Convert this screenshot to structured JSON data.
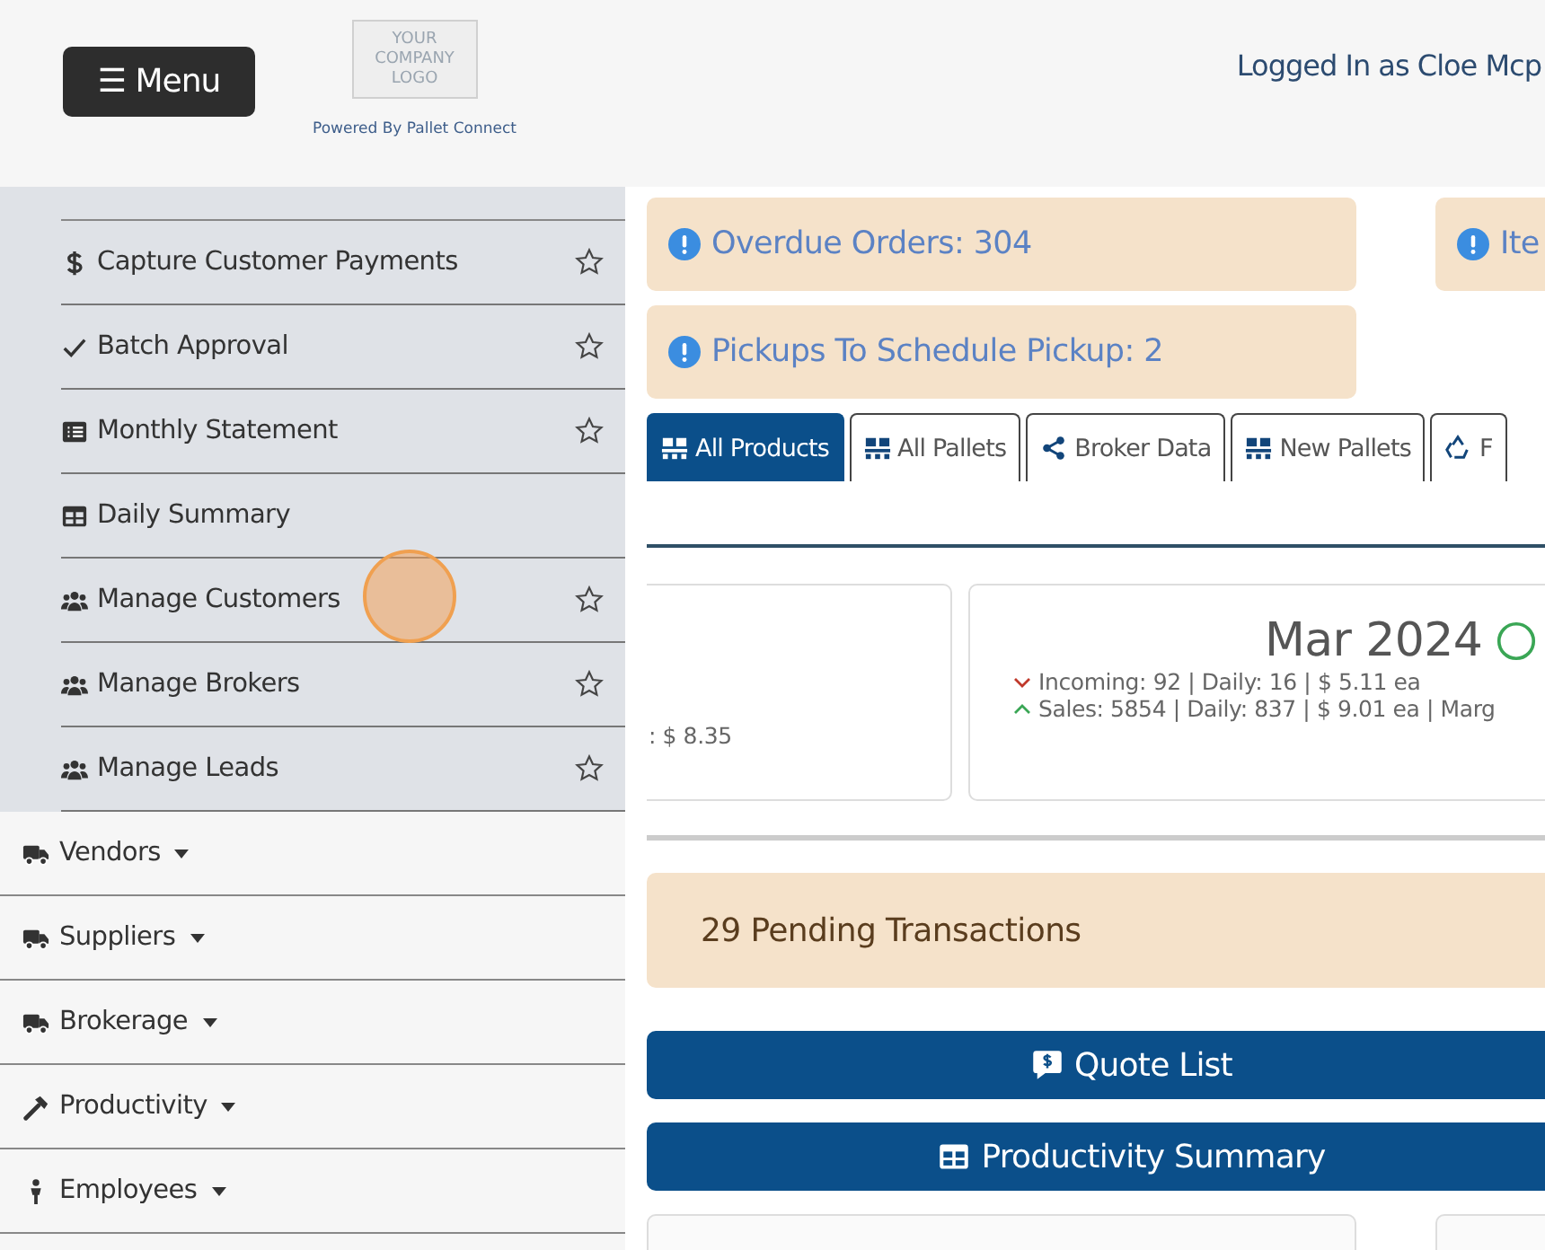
{
  "header": {
    "menu_button": "☰ Menu",
    "logo_lines": [
      "YOUR",
      "COMPANY",
      "LOGO"
    ],
    "powered_by": "Powered By Pallet Connect",
    "user": "Logged In as Cloe Mcp"
  },
  "sidebar": {
    "submenu": [
      {
        "kind": "dollar",
        "label": "Capture Customer Payments",
        "star": true
      },
      {
        "kind": "check",
        "label": "Batch Approval",
        "star": true
      },
      {
        "kind": "list",
        "label": "Monthly Statement",
        "star": true
      },
      {
        "kind": "table",
        "label": "Daily Summary",
        "star": false
      },
      {
        "kind": "users",
        "label": "Manage Customers",
        "star": true
      },
      {
        "kind": "users",
        "label": "Manage Brokers",
        "star": true
      },
      {
        "kind": "users",
        "label": "Manage Leads",
        "star": true
      }
    ],
    "menus": [
      {
        "kind": "truck",
        "label": "Vendors"
      },
      {
        "kind": "truck",
        "label": "Suppliers"
      },
      {
        "kind": "truck",
        "label": "Brokerage"
      },
      {
        "kind": "hammer",
        "label": "Productivity"
      },
      {
        "kind": "person",
        "label": "Employees"
      }
    ]
  },
  "alerts": [
    {
      "text": "Overdue Orders: 304"
    },
    {
      "text": "Ite"
    },
    {
      "text": "Pickups To Schedule Pickup: 2"
    }
  ],
  "tabs": [
    {
      "kind": "pallet",
      "label": "All Products",
      "selected": true
    },
    {
      "kind": "pallet",
      "label": "All Pallets",
      "selected": false
    },
    {
      "kind": "share",
      "label": "Broker Data",
      "selected": false
    },
    {
      "kind": "pallet",
      "label": "New Pallets",
      "selected": false
    },
    {
      "kind": "recycle",
      "label": "F",
      "selected": false
    }
  ],
  "cards": [
    {
      "lines": [
        ": $ 8.35"
      ]
    },
    {
      "title": "Mar 2024",
      "incoming": "Incoming: 92 | Daily: 16 | $ 5.11 ea",
      "sales": "Sales: 5854 | Daily: 837 | $ 9.01 ea | Marg"
    }
  ],
  "pending": "29 Pending Transactions",
  "buttons": [
    {
      "kind": "comment-dollar",
      "label": "Quote List"
    },
    {
      "kind": "table",
      "label": "Productivity Summary"
    }
  ]
}
